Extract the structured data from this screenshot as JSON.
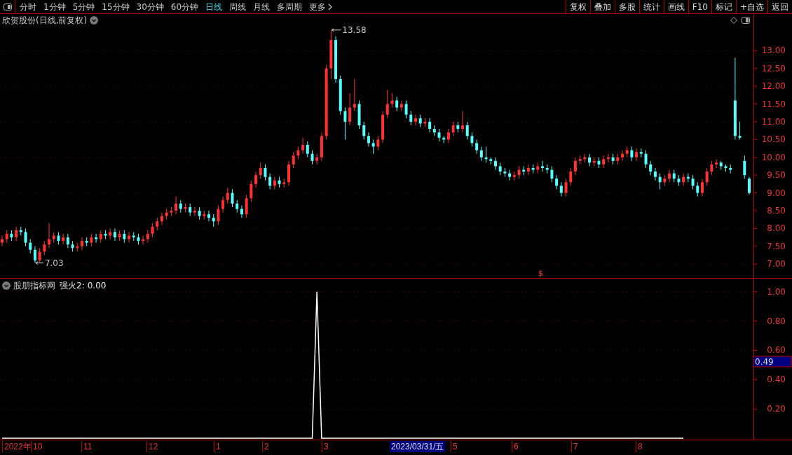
{
  "toolbar": {
    "tabs": [
      {
        "label": "分时",
        "selected": false
      },
      {
        "label": "1分钟",
        "selected": false
      },
      {
        "label": "5分钟",
        "selected": false
      },
      {
        "label": "15分钟",
        "selected": false
      },
      {
        "label": "30分钟",
        "selected": false
      },
      {
        "label": "60分钟",
        "selected": false
      },
      {
        "label": "日线",
        "selected": true
      },
      {
        "label": "周线",
        "selected": false
      },
      {
        "label": "月线",
        "selected": false
      },
      {
        "label": "多周期",
        "selected": false
      },
      {
        "label": "更多",
        "selected": false
      }
    ],
    "buttons": [
      "复权",
      "叠加",
      "多股",
      "统计",
      "画线",
      "F10",
      "标记",
      "+自选",
      "返回"
    ]
  },
  "main_chart": {
    "title": "欣贺股份(日线,前复权)",
    "high_label": "13.58",
    "low_label": "7.03",
    "marker": "$",
    "chart_data": {
      "type": "candlestick",
      "grid": true,
      "ylim": [
        6.65,
        13.99
      ],
      "yticks": [
        {
          "value": 13,
          "label": "13.00"
        },
        {
          "value": 12.5,
          "label": "12.50"
        },
        {
          "value": 12,
          "label": "12.00"
        },
        {
          "value": 11.5,
          "label": "11.50"
        },
        {
          "value": 11,
          "label": "11.00"
        },
        {
          "value": 10.5,
          "label": "10.50"
        },
        {
          "value": 10,
          "label": "10.00"
        },
        {
          "value": 9.5,
          "label": "9.50"
        },
        {
          "value": 9,
          "label": "9.00"
        },
        {
          "value": 8.5,
          "label": "8.50"
        },
        {
          "value": 8,
          "label": "8.00"
        },
        {
          "value": 7.5,
          "label": "7.50"
        },
        {
          "value": 7,
          "label": "7.00"
        }
      ],
      "categories": [
        null,
        null,
        null,
        null,
        null,
        null,
        null,
        null,
        null,
        null,
        null,
        null,
        null,
        null,
        null,
        null,
        null,
        null,
        null,
        null,
        null,
        null,
        null,
        null,
        null,
        null,
        null,
        null,
        null,
        null,
        null,
        null,
        null,
        null,
        null,
        null,
        null,
        null,
        null,
        null,
        null,
        null,
        null,
        null,
        null,
        null,
        null,
        null,
        null,
        null,
        null,
        null,
        null,
        null,
        null,
        null,
        null,
        null,
        null,
        null,
        null,
        null,
        null,
        null,
        null,
        null,
        null,
        null,
        null,
        null,
        null,
        null,
        null,
        null,
        null,
        null,
        null,
        null,
        null,
        null,
        null,
        null,
        null,
        null,
        null,
        null,
        null,
        null,
        null,
        null,
        null,
        null,
        null,
        null,
        null,
        null,
        null,
        null,
        null,
        null,
        null,
        null,
        null,
        null,
        null,
        null,
        null,
        null,
        null,
        null,
        null,
        null,
        null,
        null,
        null,
        null,
        null,
        null,
        null,
        null,
        null,
        null,
        null,
        null,
        null,
        null,
        null,
        null,
        null,
        null,
        null,
        null,
        null,
        null,
        null,
        null,
        null,
        null,
        null,
        null,
        null,
        null,
        null,
        null,
        null,
        null,
        null,
        null,
        null,
        null,
        null,
        null,
        null,
        null,
        null,
        null,
        null,
        null,
        null,
        null
      ],
      "ohlc": [
        [
          7.6,
          7.8,
          7.5,
          7.7
        ],
        [
          7.7,
          7.95,
          7.6,
          7.85
        ],
        [
          7.85,
          7.95,
          7.65,
          7.75
        ],
        [
          7.75,
          8.05,
          7.65,
          7.95
        ],
        [
          7.95,
          8.05,
          7.8,
          7.9
        ],
        [
          7.9,
          8.0,
          7.5,
          7.6
        ],
        [
          7.6,
          7.7,
          7.3,
          7.4
        ],
        [
          7.4,
          7.5,
          7.03,
          7.1
        ],
        [
          7.1,
          7.45,
          7.05,
          7.35
        ],
        [
          7.35,
          7.65,
          7.25,
          7.55
        ],
        [
          7.55,
          8.15,
          7.45,
          7.7
        ],
        [
          7.7,
          7.9,
          7.6,
          7.8
        ],
        [
          7.8,
          7.9,
          7.55,
          7.65
        ],
        [
          7.65,
          7.85,
          7.55,
          7.75
        ],
        [
          7.75,
          7.85,
          7.45,
          7.55
        ],
        [
          7.55,
          7.65,
          7.35,
          7.45
        ],
        [
          7.45,
          7.6,
          7.35,
          7.5
        ],
        [
          7.5,
          7.75,
          7.4,
          7.65
        ],
        [
          7.65,
          7.75,
          7.5,
          7.6
        ],
        [
          7.6,
          7.85,
          7.5,
          7.75
        ],
        [
          7.75,
          7.85,
          7.6,
          7.7
        ],
        [
          7.7,
          7.95,
          7.6,
          7.85
        ],
        [
          7.85,
          7.95,
          7.7,
          7.8
        ],
        [
          7.8,
          8.0,
          7.7,
          7.9
        ],
        [
          7.9,
          8.0,
          7.65,
          7.75
        ],
        [
          7.75,
          7.95,
          7.65,
          7.85
        ],
        [
          7.85,
          7.95,
          7.6,
          7.7
        ],
        [
          7.7,
          7.9,
          7.6,
          7.8
        ],
        [
          7.8,
          7.9,
          7.65,
          7.75
        ],
        [
          7.75,
          7.85,
          7.55,
          7.65
        ],
        [
          7.65,
          7.8,
          7.55,
          7.7
        ],
        [
          7.7,
          7.95,
          7.6,
          7.85
        ],
        [
          7.85,
          8.15,
          7.75,
          8.05
        ],
        [
          8.05,
          8.3,
          7.95,
          8.2
        ],
        [
          8.2,
          8.45,
          8.1,
          8.35
        ],
        [
          8.35,
          8.55,
          8.25,
          8.45
        ],
        [
          8.45,
          8.6,
          8.35,
          8.5
        ],
        [
          8.5,
          8.9,
          8.4,
          8.7
        ],
        [
          8.7,
          8.8,
          8.45,
          8.55
        ],
        [
          8.55,
          8.7,
          8.45,
          8.6
        ],
        [
          8.6,
          8.7,
          8.35,
          8.45
        ],
        [
          8.45,
          8.6,
          8.35,
          8.5
        ],
        [
          8.5,
          8.6,
          8.25,
          8.35
        ],
        [
          8.35,
          8.5,
          8.25,
          8.4
        ],
        [
          8.4,
          8.5,
          8.2,
          8.3
        ],
        [
          8.3,
          8.4,
          8.05,
          8.2
        ],
        [
          8.2,
          8.65,
          8.1,
          8.55
        ],
        [
          8.55,
          8.9,
          8.45,
          8.8
        ],
        [
          8.8,
          9.15,
          8.7,
          9.0
        ],
        [
          9.0,
          9.1,
          8.6,
          8.7
        ],
        [
          8.7,
          8.8,
          8.45,
          8.55
        ],
        [
          8.55,
          8.65,
          8.3,
          8.4
        ],
        [
          8.4,
          8.95,
          8.3,
          8.85
        ],
        [
          8.85,
          9.35,
          8.75,
          9.25
        ],
        [
          9.25,
          9.6,
          9.15,
          9.5
        ],
        [
          9.5,
          9.85,
          9.4,
          9.7
        ],
        [
          9.7,
          9.8,
          9.35,
          9.45
        ],
        [
          9.45,
          9.55,
          9.1,
          9.2
        ],
        [
          9.2,
          9.45,
          9.1,
          9.35
        ],
        [
          9.35,
          9.45,
          9.15,
          9.25
        ],
        [
          9.25,
          9.4,
          9.15,
          9.3
        ],
        [
          9.3,
          9.9,
          9.2,
          9.8
        ],
        [
          9.8,
          10.15,
          9.7,
          10.05
        ],
        [
          10.05,
          10.3,
          9.95,
          10.2
        ],
        [
          10.2,
          10.55,
          10.1,
          10.35
        ],
        [
          10.35,
          10.45,
          10.0,
          10.1
        ],
        [
          10.1,
          10.2,
          9.8,
          9.9
        ],
        [
          9.9,
          10.1,
          9.8,
          10.0
        ],
        [
          10.0,
          10.7,
          9.9,
          10.6
        ],
        [
          10.6,
          12.6,
          10.5,
          12.5
        ],
        [
          12.5,
          13.58,
          12.2,
          13.3
        ],
        [
          13.3,
          13.4,
          12.1,
          12.2
        ],
        [
          12.2,
          12.3,
          11.2,
          11.3
        ],
        [
          11.3,
          11.4,
          10.5,
          11.0
        ],
        [
          11.0,
          11.8,
          10.9,
          11.4
        ],
        [
          11.4,
          12.2,
          11.3,
          11.5
        ],
        [
          11.5,
          11.6,
          10.8,
          10.9
        ],
        [
          10.9,
          11.0,
          10.5,
          10.6
        ],
        [
          10.6,
          10.7,
          10.3,
          10.4
        ],
        [
          10.4,
          10.5,
          10.1,
          10.3
        ],
        [
          10.3,
          10.6,
          10.2,
          10.5
        ],
        [
          10.5,
          11.3,
          10.4,
          11.2
        ],
        [
          11.2,
          11.9,
          11.1,
          11.5
        ],
        [
          11.5,
          11.8,
          11.4,
          11.6
        ],
        [
          11.6,
          11.7,
          11.3,
          11.4
        ],
        [
          11.4,
          11.6,
          11.3,
          11.5
        ],
        [
          11.5,
          11.6,
          11.1,
          11.2
        ],
        [
          11.2,
          11.3,
          10.9,
          11.0
        ],
        [
          11.0,
          11.2,
          10.9,
          11.1
        ],
        [
          11.1,
          11.2,
          10.85,
          10.95
        ],
        [
          10.95,
          11.1,
          10.85,
          11.0
        ],
        [
          11.0,
          11.1,
          10.7,
          10.8
        ],
        [
          10.8,
          10.9,
          10.6,
          10.7
        ],
        [
          10.7,
          10.8,
          10.45,
          10.55
        ],
        [
          10.55,
          10.6,
          10.4,
          10.5
        ],
        [
          10.5,
          10.8,
          10.4,
          10.7
        ],
        [
          10.7,
          11.0,
          10.6,
          10.9
        ],
        [
          10.9,
          11.0,
          10.7,
          10.8
        ],
        [
          10.8,
          11.3,
          10.7,
          10.9
        ],
        [
          10.9,
          11.0,
          10.5,
          10.6
        ],
        [
          10.6,
          10.7,
          10.3,
          10.4
        ],
        [
          10.4,
          10.5,
          10.1,
          10.2
        ],
        [
          10.2,
          10.3,
          9.9,
          10.0
        ],
        [
          10.0,
          10.3,
          9.85,
          9.95
        ],
        [
          9.95,
          10.0,
          9.8,
          9.9
        ],
        [
          9.9,
          10.0,
          9.65,
          9.75
        ],
        [
          9.75,
          9.85,
          9.5,
          9.6
        ],
        [
          9.6,
          9.7,
          9.45,
          9.55
        ],
        [
          9.55,
          9.65,
          9.35,
          9.45
        ],
        [
          9.45,
          9.6,
          9.35,
          9.5
        ],
        [
          9.5,
          9.75,
          9.4,
          9.65
        ],
        [
          9.65,
          9.75,
          9.5,
          9.6
        ],
        [
          9.6,
          9.8,
          9.5,
          9.7
        ],
        [
          9.7,
          9.8,
          9.55,
          9.65
        ],
        [
          9.65,
          9.85,
          9.55,
          9.75
        ],
        [
          9.75,
          9.9,
          9.6,
          9.7
        ],
        [
          9.7,
          9.8,
          9.55,
          9.65
        ],
        [
          9.65,
          9.75,
          9.3,
          9.4
        ],
        [
          9.4,
          9.5,
          9.1,
          9.2
        ],
        [
          9.2,
          9.3,
          8.9,
          9.0
        ],
        [
          9.0,
          9.4,
          8.9,
          9.3
        ],
        [
          9.3,
          9.7,
          9.2,
          9.6
        ],
        [
          9.6,
          10.0,
          9.5,
          9.9
        ],
        [
          9.9,
          10.05,
          9.8,
          9.95
        ],
        [
          9.95,
          10.1,
          9.85,
          10.0
        ],
        [
          10.0,
          10.1,
          9.75,
          9.85
        ],
        [
          9.85,
          10.0,
          9.75,
          9.9
        ],
        [
          9.9,
          10.0,
          9.7,
          9.8
        ],
        [
          9.8,
          10.05,
          9.7,
          9.95
        ],
        [
          9.95,
          10.1,
          9.85,
          10.0
        ],
        [
          10.0,
          10.1,
          9.8,
          9.9
        ],
        [
          9.9,
          10.1,
          9.8,
          10.0
        ],
        [
          10.0,
          10.2,
          9.9,
          10.1
        ],
        [
          10.1,
          10.3,
          10.0,
          10.2
        ],
        [
          10.2,
          10.3,
          9.9,
          10.0
        ],
        [
          10.0,
          10.25,
          9.9,
          10.15
        ],
        [
          10.15,
          10.25,
          10.0,
          10.1
        ],
        [
          10.1,
          10.2,
          9.7,
          9.8
        ],
        [
          9.8,
          9.9,
          9.5,
          9.6
        ],
        [
          9.6,
          9.7,
          9.35,
          9.45
        ],
        [
          9.45,
          9.55,
          9.1,
          9.3
        ],
        [
          9.3,
          9.5,
          9.2,
          9.4
        ],
        [
          9.4,
          9.65,
          9.3,
          9.55
        ],
        [
          9.55,
          9.65,
          9.3,
          9.4
        ],
        [
          9.4,
          9.5,
          9.2,
          9.3
        ],
        [
          9.3,
          9.55,
          9.2,
          9.45
        ],
        [
          9.45,
          9.55,
          9.3,
          9.4
        ],
        [
          9.4,
          9.5,
          9.1,
          9.2
        ],
        [
          9.2,
          9.3,
          8.9,
          9.0
        ],
        [
          9.0,
          9.4,
          8.9,
          9.3
        ],
        [
          9.3,
          9.7,
          9.2,
          9.6
        ],
        [
          9.6,
          9.9,
          9.5,
          9.8
        ],
        [
          9.8,
          9.95,
          9.7,
          9.85
        ],
        [
          9.85,
          9.9,
          9.65,
          9.75
        ],
        [
          9.75,
          9.8,
          9.6,
          9.7
        ],
        [
          9.7,
          9.8,
          9.55,
          9.65
        ],
        [
          11.6,
          12.8,
          10.5,
          10.6
        ],
        [
          10.6,
          11.0,
          10.5,
          10.55
        ],
        [
          9.9,
          10.05,
          9.4,
          9.5
        ],
        [
          9.4,
          9.45,
          8.95,
          9.0
        ]
      ]
    }
  },
  "indicator": {
    "source": "股朋指标网",
    "value": "0.00",
    "cursor_value": "0.49",
    "chart_data": {
      "type": "line",
      "grid": true,
      "ylim": [
        0,
        1.08
      ],
      "yticks": [
        {
          "value": 1,
          "label": "1.00"
        },
        {
          "value": 0.8,
          "label": "0.80"
        },
        {
          "value": 0.6,
          "label": "0.60"
        },
        {
          "value": 0.4,
          "label": "0.40"
        },
        {
          "value": 0.2,
          "label": "0.20"
        }
      ],
      "categories": [
        null,
        null,
        null,
        null,
        null,
        null,
        null,
        null,
        null,
        null,
        null,
        null,
        null,
        null,
        null,
        null,
        null,
        null,
        null,
        null,
        null,
        null,
        null,
        null,
        null,
        null,
        null,
        null,
        null,
        null,
        null,
        null,
        null,
        null,
        null,
        null,
        null,
        null,
        null,
        null,
        null,
        null,
        null,
        null,
        null,
        null,
        null,
        null,
        null,
        null,
        null,
        null,
        null,
        null,
        null,
        null,
        null,
        null,
        null,
        null,
        null,
        null,
        null,
        null,
        null,
        null,
        null,
        null,
        null,
        null,
        null,
        null,
        null,
        null,
        null,
        null,
        null,
        null,
        null,
        null,
        null,
        null,
        null,
        null,
        null,
        null,
        null,
        null,
        null,
        null,
        null,
        null,
        null,
        null,
        null,
        null,
        null,
        null,
        null,
        null,
        null,
        null,
        null,
        null,
        null,
        null,
        null,
        null,
        null,
        null,
        null,
        null,
        null,
        null,
        null,
        null,
        null,
        null,
        null,
        null,
        null,
        null,
        null,
        null,
        null,
        null,
        null,
        null,
        null,
        null,
        null,
        null,
        null,
        null,
        null,
        null,
        null,
        null,
        null,
        null,
        null,
        null,
        null,
        null,
        null,
        null,
        null,
        null,
        null,
        null,
        null,
        null,
        null,
        null,
        null,
        null,
        null,
        null,
        null,
        null
      ],
      "series": [
        {
          "name": "强火2:",
          "color": "#ffffff",
          "values": [
            0,
            0,
            0,
            0,
            0,
            0,
            0,
            0,
            0,
            0,
            0,
            0,
            0,
            0,
            0,
            0,
            0,
            0,
            0,
            0,
            0,
            0,
            0,
            0,
            0,
            0,
            0,
            0,
            0,
            0,
            0,
            0,
            0,
            0,
            0,
            0,
            0,
            0,
            0,
            0,
            0,
            0,
            0,
            0,
            0,
            0,
            0,
            0,
            0,
            0,
            0,
            0,
            0,
            0,
            0,
            0,
            0,
            0,
            0,
            0,
            0,
            0,
            0,
            0,
            0,
            0,
            0,
            1,
            0,
            0,
            0,
            0,
            0,
            0,
            0,
            0,
            0,
            0,
            0,
            0,
            0,
            0,
            0,
            0,
            0,
            0,
            0,
            0,
            0,
            0,
            0,
            0,
            0,
            0,
            0,
            0,
            0,
            0,
            0,
            0,
            0,
            0,
            0,
            0,
            0,
            0,
            0,
            0,
            0,
            0,
            0,
            0,
            0,
            0,
            0,
            0,
            0,
            0,
            0,
            0,
            0,
            0,
            0,
            0,
            0,
            0,
            0,
            0,
            0,
            0,
            0,
            0,
            0,
            0,
            0,
            0,
            0,
            0,
            0,
            0,
            0,
            0,
            0,
            0,
            0,
            0,
            null,
            null,
            null,
            null,
            null,
            null,
            null,
            null,
            null,
            null,
            null,
            null,
            null,
            null
          ]
        }
      ]
    }
  },
  "x_axis": {
    "labels": [
      "2022年",
      "10",
      "11",
      "12",
      "1",
      "2",
      "3",
      "5",
      "6",
      "7",
      "8"
    ],
    "cursor_date": "2023/03/31/五"
  }
}
